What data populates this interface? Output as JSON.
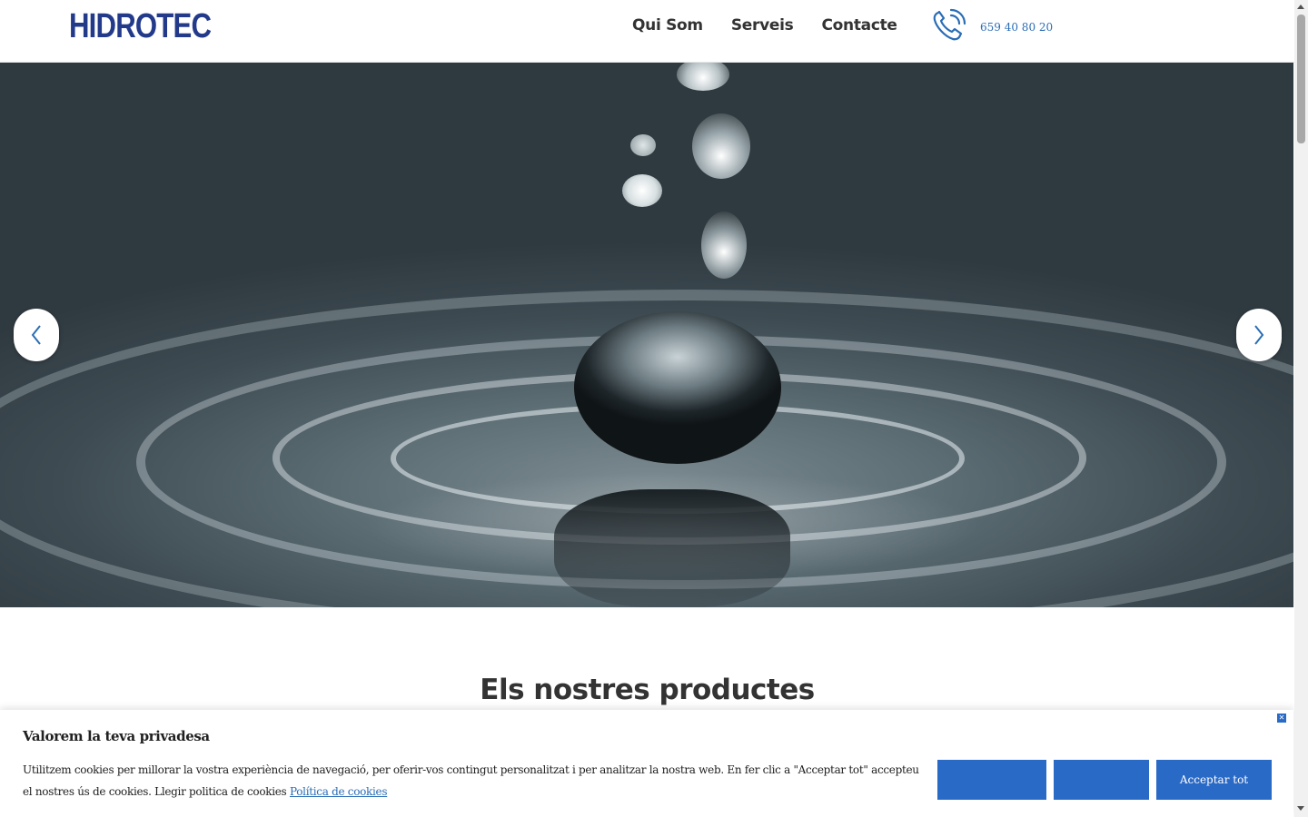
{
  "header": {
    "logo": "HIDROTEC",
    "nav": [
      "Qui Som",
      "Serveis",
      "Contacte"
    ],
    "phone": "659 40 80 20",
    "phone_icon": "phone-ringing-icon",
    "brand_color": "#233a8b",
    "accent_color": "#2a6db5"
  },
  "hero": {
    "image": "water-drop-splash",
    "prev_icon": "chevron-left-icon",
    "next_icon": "chevron-right-icon"
  },
  "products": {
    "title": "Els nostres productes"
  },
  "cookie": {
    "title": "Valorem la teva privadesa",
    "text": "Utilitzem cookies per millorar la vostra experiència de navegació, per oferir-vos contingut personalitzat i per analitzar la nostra web. En fer clic a \"Acceptar tot\" accepteu el nostres ús de cookies. Llegir politica de cookies",
    "link": "Política de cookies",
    "accept_all": "Acceptar tot",
    "close_icon": "close-icon",
    "button_color": "#2a6ac7"
  }
}
